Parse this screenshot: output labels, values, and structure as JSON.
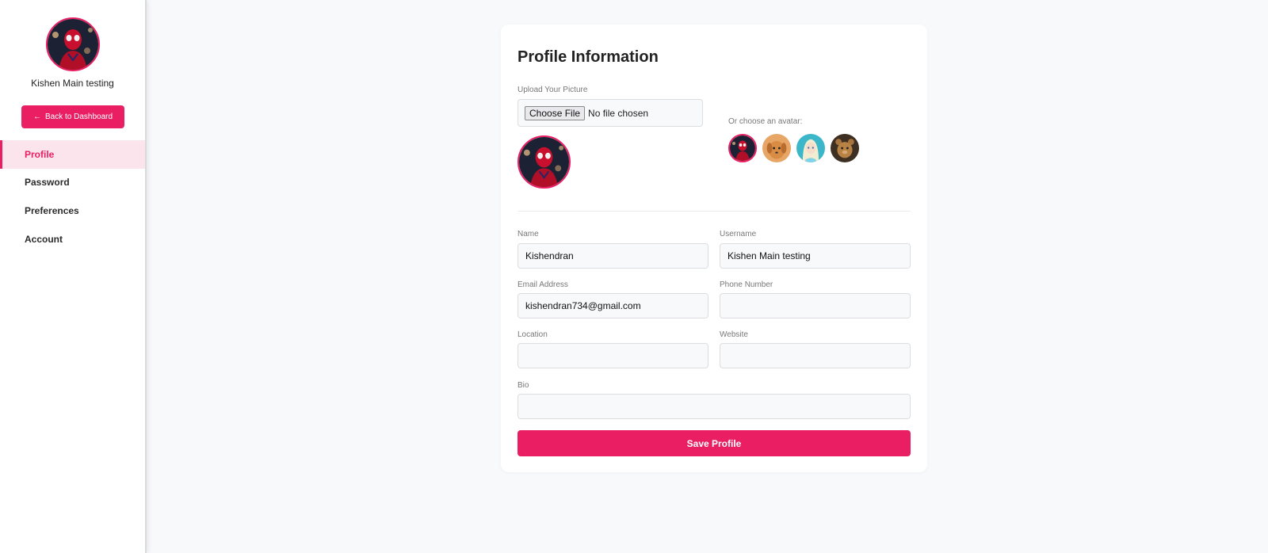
{
  "sidebar": {
    "user_name": "Kishen Main testing",
    "back_button": "Back to Dashboard",
    "back_arrow": "←",
    "nav": [
      {
        "label": "Profile",
        "active": true
      },
      {
        "label": "Password",
        "active": false
      },
      {
        "label": "Preferences",
        "active": false
      },
      {
        "label": "Account",
        "active": false
      }
    ]
  },
  "profile": {
    "title": "Profile Information",
    "upload_label": "Upload Your Picture",
    "choose_file": "Choose File",
    "no_file": "No file chosen",
    "avatar_label": "Or choose an avatar:",
    "avatars": [
      "spiderman-avatar",
      "puppy-avatar",
      "elsa-avatar",
      "teddy-avatar"
    ],
    "fields": {
      "name": {
        "label": "Name",
        "value": "Kishendran"
      },
      "username": {
        "label": "Username",
        "value": "Kishen Main testing"
      },
      "email": {
        "label": "Email Address",
        "value": "kishendran734@gmail.com"
      },
      "phone": {
        "label": "Phone Number",
        "value": ""
      },
      "location": {
        "label": "Location",
        "value": ""
      },
      "website": {
        "label": "Website",
        "value": ""
      },
      "bio": {
        "label": "Bio",
        "value": ""
      }
    },
    "save_button": "Save Profile"
  },
  "colors": {
    "accent": "#e91e63",
    "accent_light": "#fce4ec",
    "background": "#f8f9fb"
  }
}
